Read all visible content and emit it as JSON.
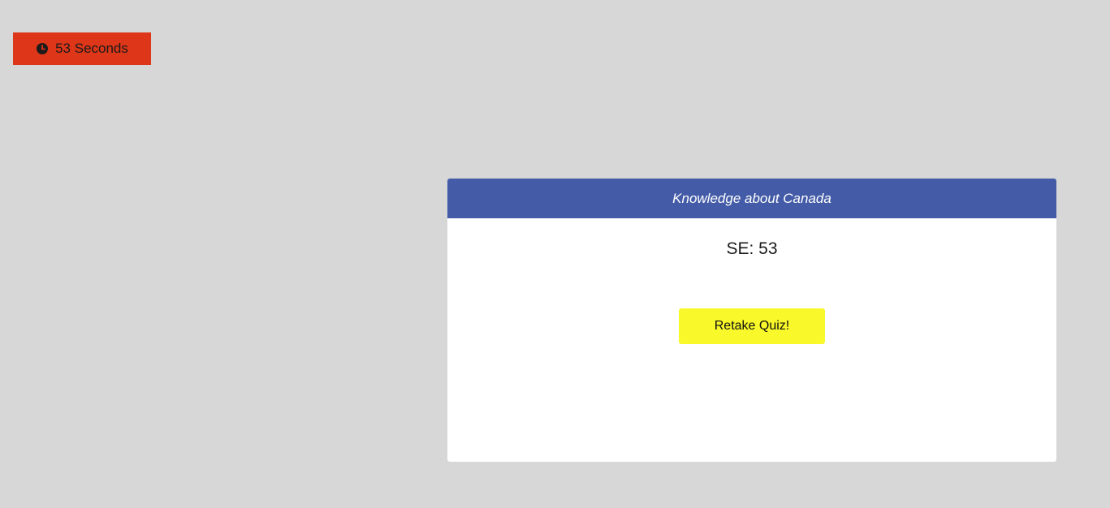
{
  "timer": {
    "icon": "clock-icon",
    "label": "53 Seconds",
    "background_color": "#dd3618"
  },
  "quiz": {
    "title": "Knowledge about Canada",
    "header_color": "#445ca7",
    "score_text": "SE: 53",
    "retake_label": "Retake Quiz!",
    "retake_color": "#f8f82a"
  },
  "page": {
    "background_color": "#d7d7d7"
  }
}
